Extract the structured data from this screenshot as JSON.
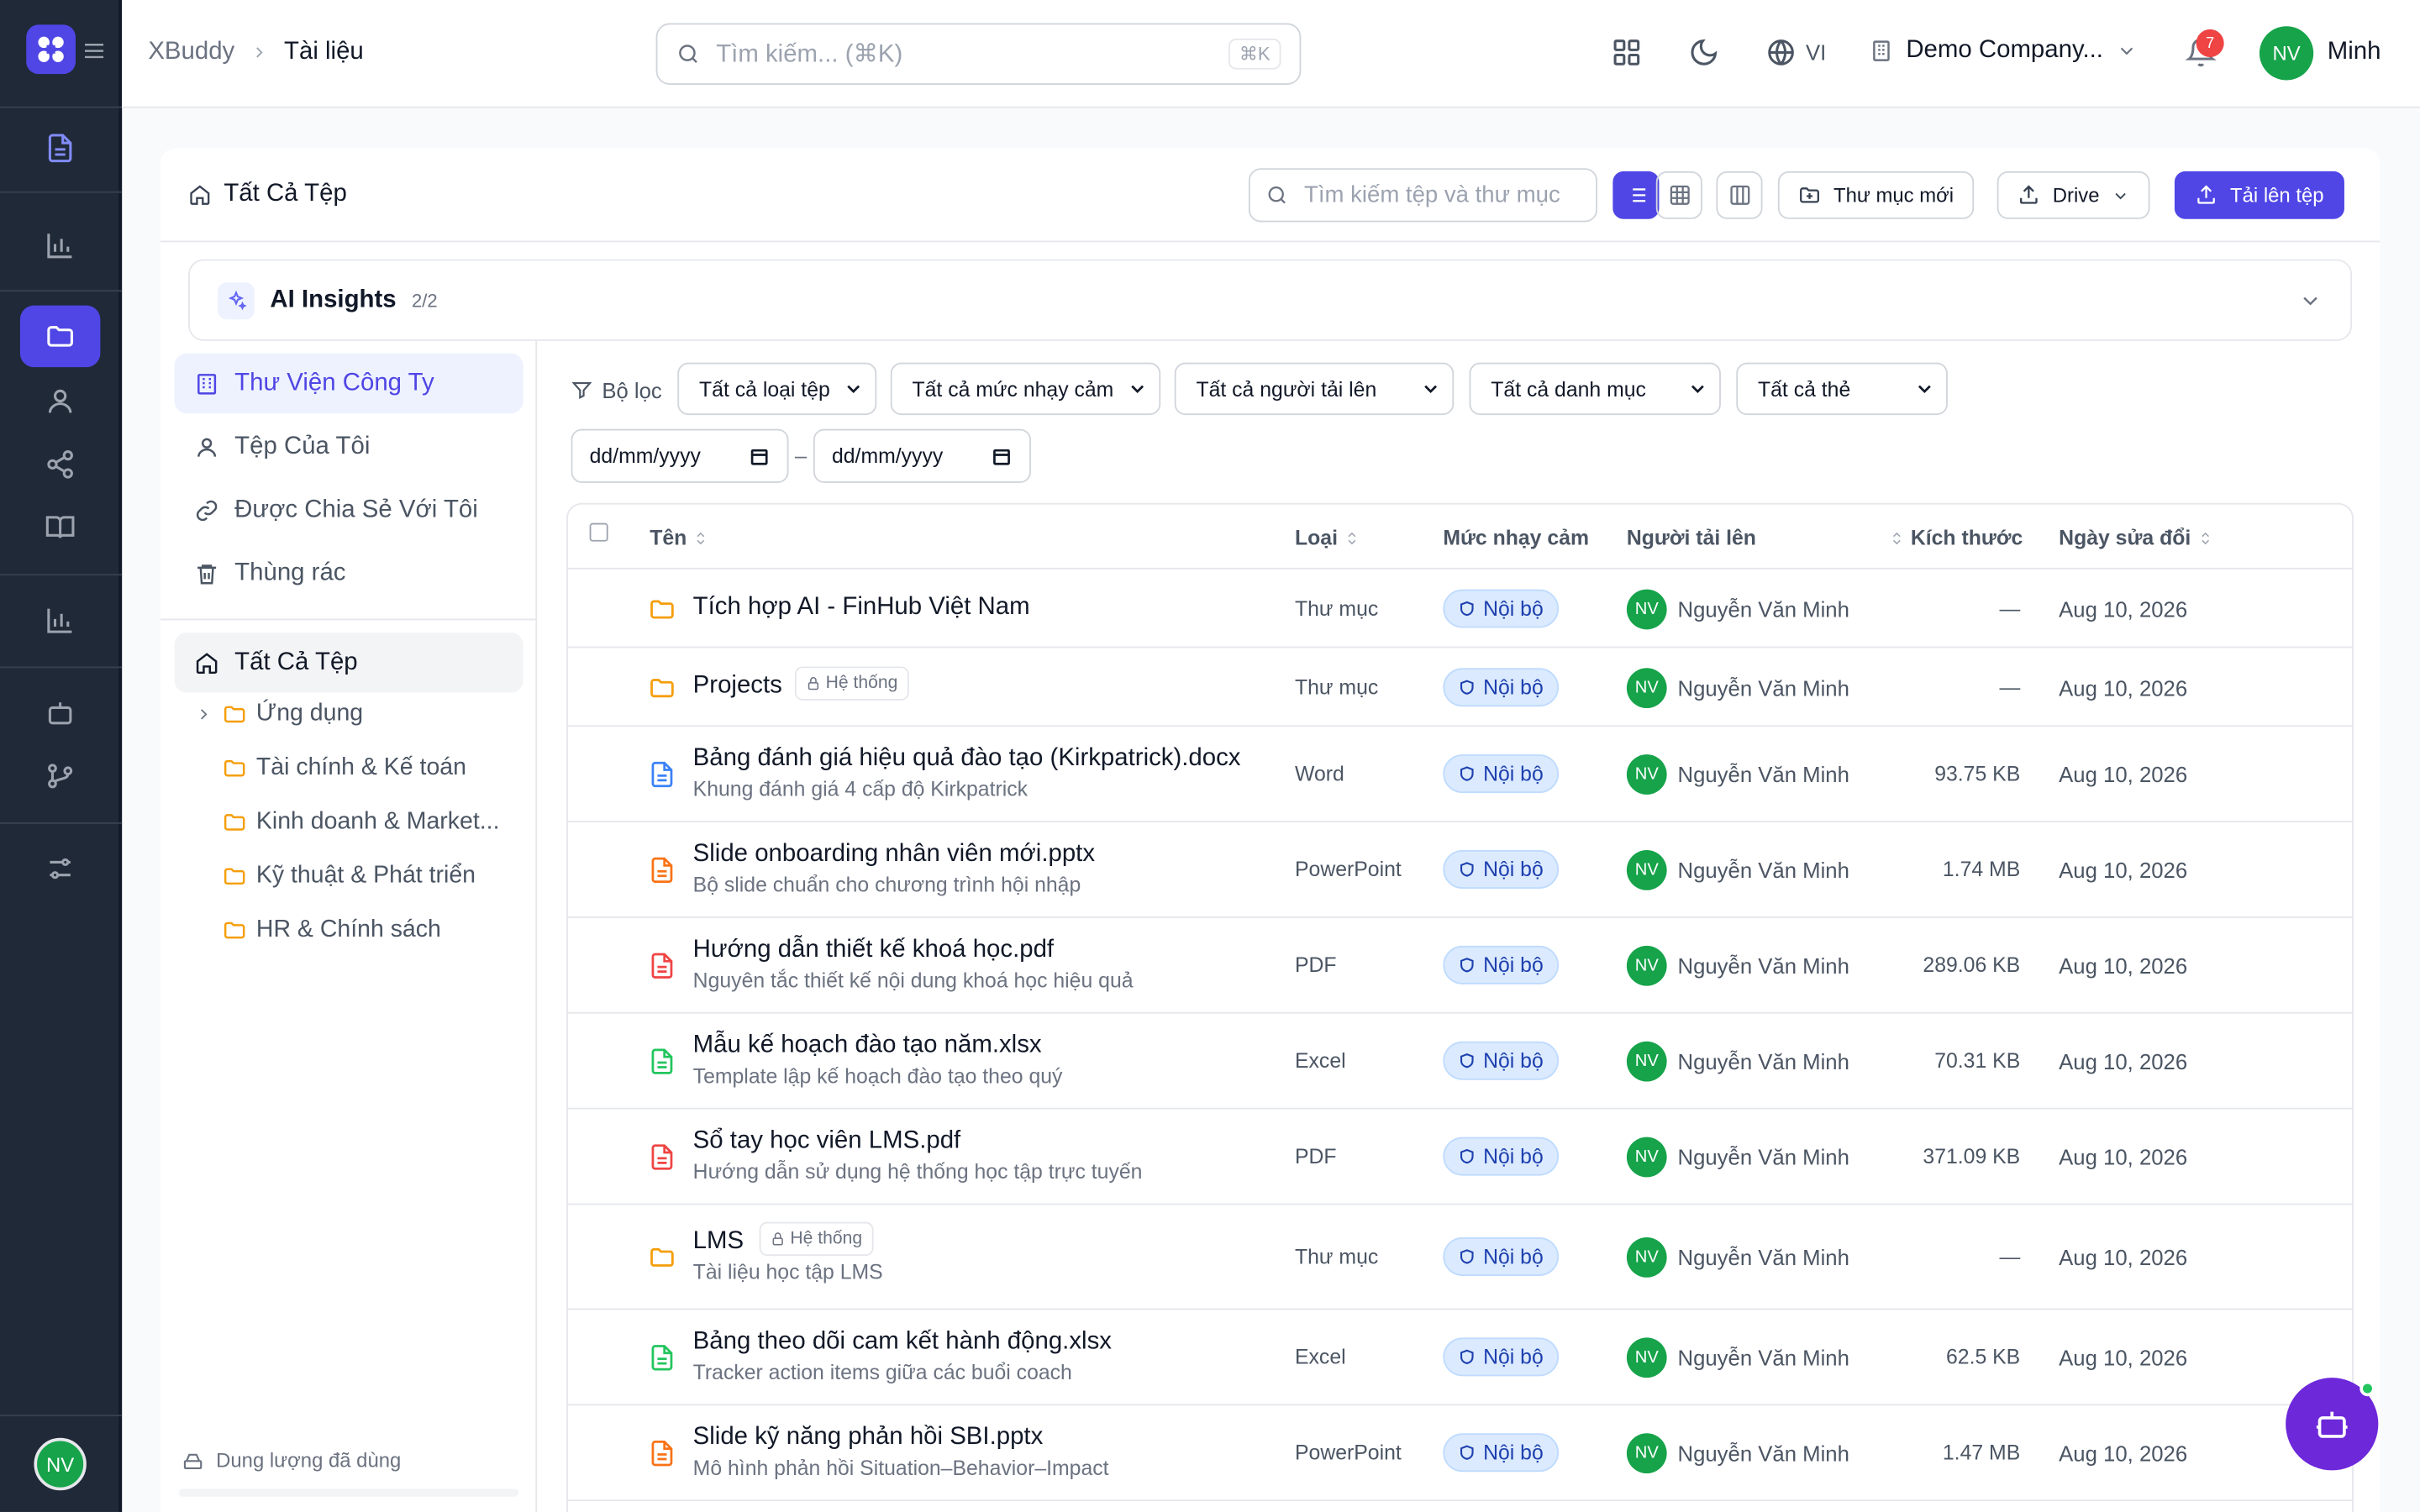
{
  "app": {
    "name": "XBuddy",
    "page": "Tài liệu"
  },
  "topbar": {
    "search_placeholder": "Tìm kiếm... (⌘K)",
    "search_shortcut": "⌘K",
    "language": "VI",
    "company": "Demo Company...",
    "notifications": "7",
    "user_initials": "NV",
    "user_name": "Minh"
  },
  "rail": {
    "avatar": "NV"
  },
  "content": {
    "title": "Tất Cả Tệp",
    "file_search_placeholder": "Tìm kiếm tệp và thư mục",
    "new_folder": "Thư mục mới",
    "drive": "Drive",
    "upload": "Tải lên tệp"
  },
  "ai_insights": {
    "title": "AI Insights",
    "count": "2/2"
  },
  "sidebar": {
    "nav": [
      {
        "label": "Thư Viện Công Ty"
      },
      {
        "label": "Tệp Của Tôi"
      },
      {
        "label": "Được Chia Sẻ Với Tôi"
      },
      {
        "label": "Thùng rác"
      }
    ],
    "root": "Tất Cả Tệp",
    "tree": [
      "Ứng dụng",
      "Tài chính & Kế toán",
      "Kinh doanh & Market...",
      "Kỹ thuật & Phát triển",
      "HR & Chính sách"
    ],
    "storage_label": "Dung lượng đã dùng"
  },
  "filters": {
    "label": "Bộ lọc",
    "type": "Tất cả loại tệp",
    "sensitivity": "Tất cả mức nhạy cảm",
    "uploader": "Tất cả người tải lên",
    "category": "Tất cả danh mục",
    "tags": "Tất cả thẻ",
    "date_from": "dd/mm/yyyy",
    "date_to": "dd/mm/yyyy",
    "date_sep": "–"
  },
  "table": {
    "columns": {
      "name": "Tên",
      "type": "Loại",
      "sensitivity": "Mức nhạy cảm",
      "uploader": "Người tải lên",
      "size": "Kích thước",
      "modified": "Ngày sửa đổi"
    },
    "rows": [
      {
        "name": "Tích hợp AI - FinHub Việt Nam",
        "desc": "",
        "tag": "",
        "type": "Thư mục",
        "sens": "Nội bộ",
        "av": "NV",
        "uploader": "Nguyễn Văn Minh",
        "size": "—",
        "date": "Aug 10, 2026",
        "icon": "folder-icon"
      },
      {
        "name": "Projects",
        "desc": "",
        "tag": "Hệ thống",
        "type": "Thư mục",
        "sens": "Nội bộ",
        "av": "NV",
        "uploader": "Nguyễn Văn Minh",
        "size": "—",
        "date": "Aug 10, 2026",
        "icon": "folder-icon"
      },
      {
        "name": "Bảng đánh giá hiệu quả đào tạo (Kirkpatrick).docx",
        "desc": "Khung đánh giá 4 cấp độ Kirkpatrick",
        "tag": "",
        "type": "Word",
        "sens": "Nội bộ",
        "av": "NV",
        "uploader": "Nguyễn Văn Minh",
        "size": "93.75 KB",
        "date": "Aug 10, 2026",
        "icon": "word-file-icon"
      },
      {
        "name": "Slide onboarding nhân viên mới.pptx",
        "desc": "Bộ slide chuẩn cho chương trình hội nhập",
        "tag": "",
        "type": "PowerPoint",
        "sens": "Nội bộ",
        "av": "NV",
        "uploader": "Nguyễn Văn Minh",
        "size": "1.74 MB",
        "date": "Aug 10, 2026",
        "icon": "powerpoint-file-icon"
      },
      {
        "name": "Hướng dẫn thiết kế khoá học.pdf",
        "desc": "Nguyên tắc thiết kế nội dung khoá học hiệu quả",
        "tag": "",
        "type": "PDF",
        "sens": "Nội bộ",
        "av": "NV",
        "uploader": "Nguyễn Văn Minh",
        "size": "289.06 KB",
        "date": "Aug 10, 2026",
        "icon": "pdf-file-icon"
      },
      {
        "name": "Mẫu kế hoạch đào tạo năm.xlsx",
        "desc": "Template lập kế hoạch đào tạo theo quý",
        "tag": "",
        "type": "Excel",
        "sens": "Nội bộ",
        "av": "NV",
        "uploader": "Nguyễn Văn Minh",
        "size": "70.31 KB",
        "date": "Aug 10, 2026",
        "icon": "excel-file-icon"
      },
      {
        "name": "Sổ tay học viên LMS.pdf",
        "desc": "Hướng dẫn sử dụng hệ thống học tập trực tuyến",
        "tag": "",
        "type": "PDF",
        "sens": "Nội bộ",
        "av": "NV",
        "uploader": "Nguyễn Văn Minh",
        "size": "371.09 KB",
        "date": "Aug 10, 2026",
        "icon": "pdf-file-icon"
      },
      {
        "name": "LMS",
        "desc": "Tài liệu học tập LMS",
        "tag": "Hệ thống",
        "type": "Thư mục",
        "sens": "Nội bộ",
        "av": "NV",
        "uploader": "Nguyễn Văn Minh",
        "size": "—",
        "date": "Aug 10, 2026",
        "icon": "folder-icon"
      },
      {
        "name": "Bảng theo dõi cam kết hành động.xlsx",
        "desc": "Tracker action items giữa các buổi coach",
        "tag": "",
        "type": "Excel",
        "sens": "Nội bộ",
        "av": "NV",
        "uploader": "Nguyễn Văn Minh",
        "size": "62.5 KB",
        "date": "Aug 10, 2026",
        "icon": "excel-file-icon"
      },
      {
        "name": "Slide kỹ năng phản hồi SBI.pptx",
        "desc": "Mô hình phản hồi Situation–Behavior–Impact",
        "tag": "",
        "type": "PowerPoint",
        "sens": "Nội bộ",
        "av": "NV",
        "uploader": "Nguyễn Văn Minh",
        "size": "1.47 MB",
        "date": "Aug 10, 2026",
        "icon": "powerpoint-file-icon"
      }
    ]
  },
  "colors": {
    "accent": "#4f46e5",
    "rail": "#1f2937",
    "folder": "#f59e0b",
    "word": "#3b82f6",
    "ppt": "#f97316",
    "pdf": "#ef4444",
    "excel": "#22c55e"
  }
}
